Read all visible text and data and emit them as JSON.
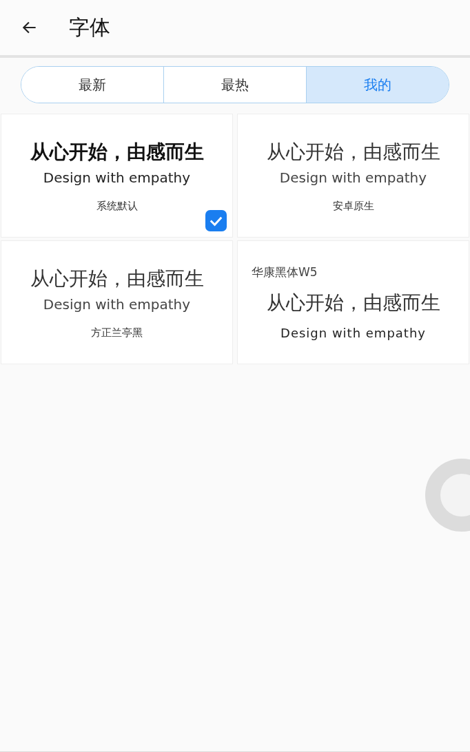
{
  "header": {
    "title": "字体"
  },
  "tabs": [
    {
      "label": "最新",
      "selected": false
    },
    {
      "label": "最热",
      "selected": false
    },
    {
      "label": "我的",
      "selected": true
    }
  ],
  "fonts": [
    {
      "kind": "name-bottom",
      "headline": "从心开始，由感而生",
      "sample": "Design with empathy",
      "name": "系统默认",
      "checked": true
    },
    {
      "kind": "name-bottom",
      "headline": "从心开始，由感而生",
      "sample": "Design with empathy",
      "name": "安卓原生",
      "checked": false
    },
    {
      "kind": "name-bottom",
      "headline": "从心开始，由感而生",
      "sample": "Design with empathy",
      "name": "方正兰亭黑",
      "checked": false
    },
    {
      "kind": "name-top",
      "headline": "从心开始，由感而生",
      "sample": "Design with empathy",
      "name": "华康黑体W5",
      "checked": false
    }
  ]
}
